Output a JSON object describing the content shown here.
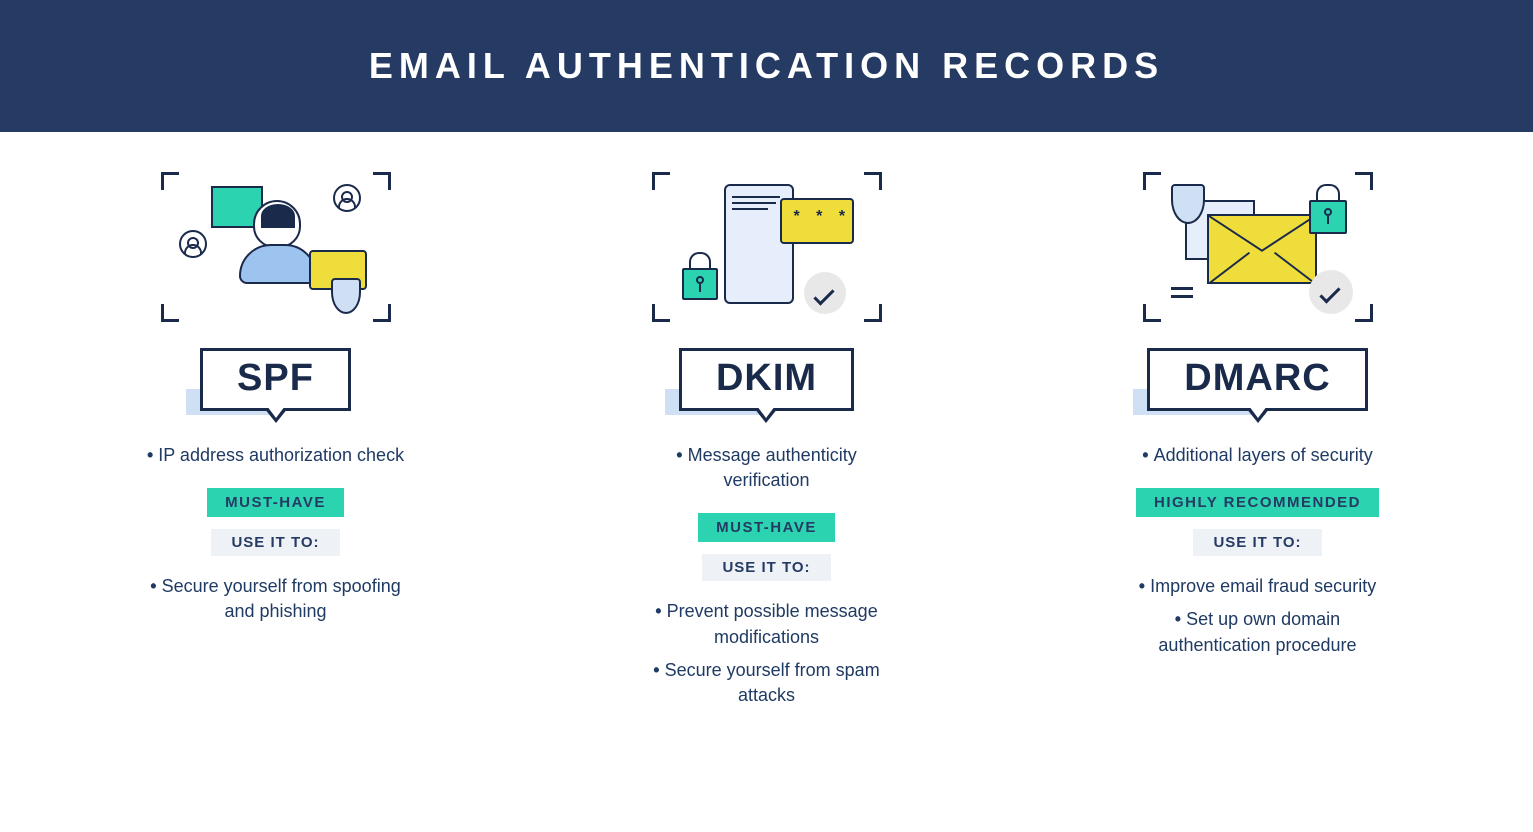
{
  "title": "EMAIL AUTHENTICATION RECORDS",
  "use_it_label": "USE IT TO:",
  "columns": [
    {
      "id": "spf",
      "label": "SPF",
      "desc": [
        "IP address authorization check"
      ],
      "priority": "MUST-HAVE",
      "uses": [
        "Secure yourself from spoofing and phishing"
      ]
    },
    {
      "id": "dkim",
      "label": "DKIM",
      "desc": [
        "Message authenticity verification"
      ],
      "priority": "MUST-HAVE",
      "uses": [
        "Prevent possible message modifications",
        "Secure yourself from spam attacks"
      ]
    },
    {
      "id": "dmarc",
      "label": "DMARC",
      "desc": [
        "Additional layers of security"
      ],
      "priority": "HIGHLY RECOMMENDED",
      "uses": [
        "Improve email fraud security",
        "Set up own domain authentication procedure"
      ]
    }
  ]
}
